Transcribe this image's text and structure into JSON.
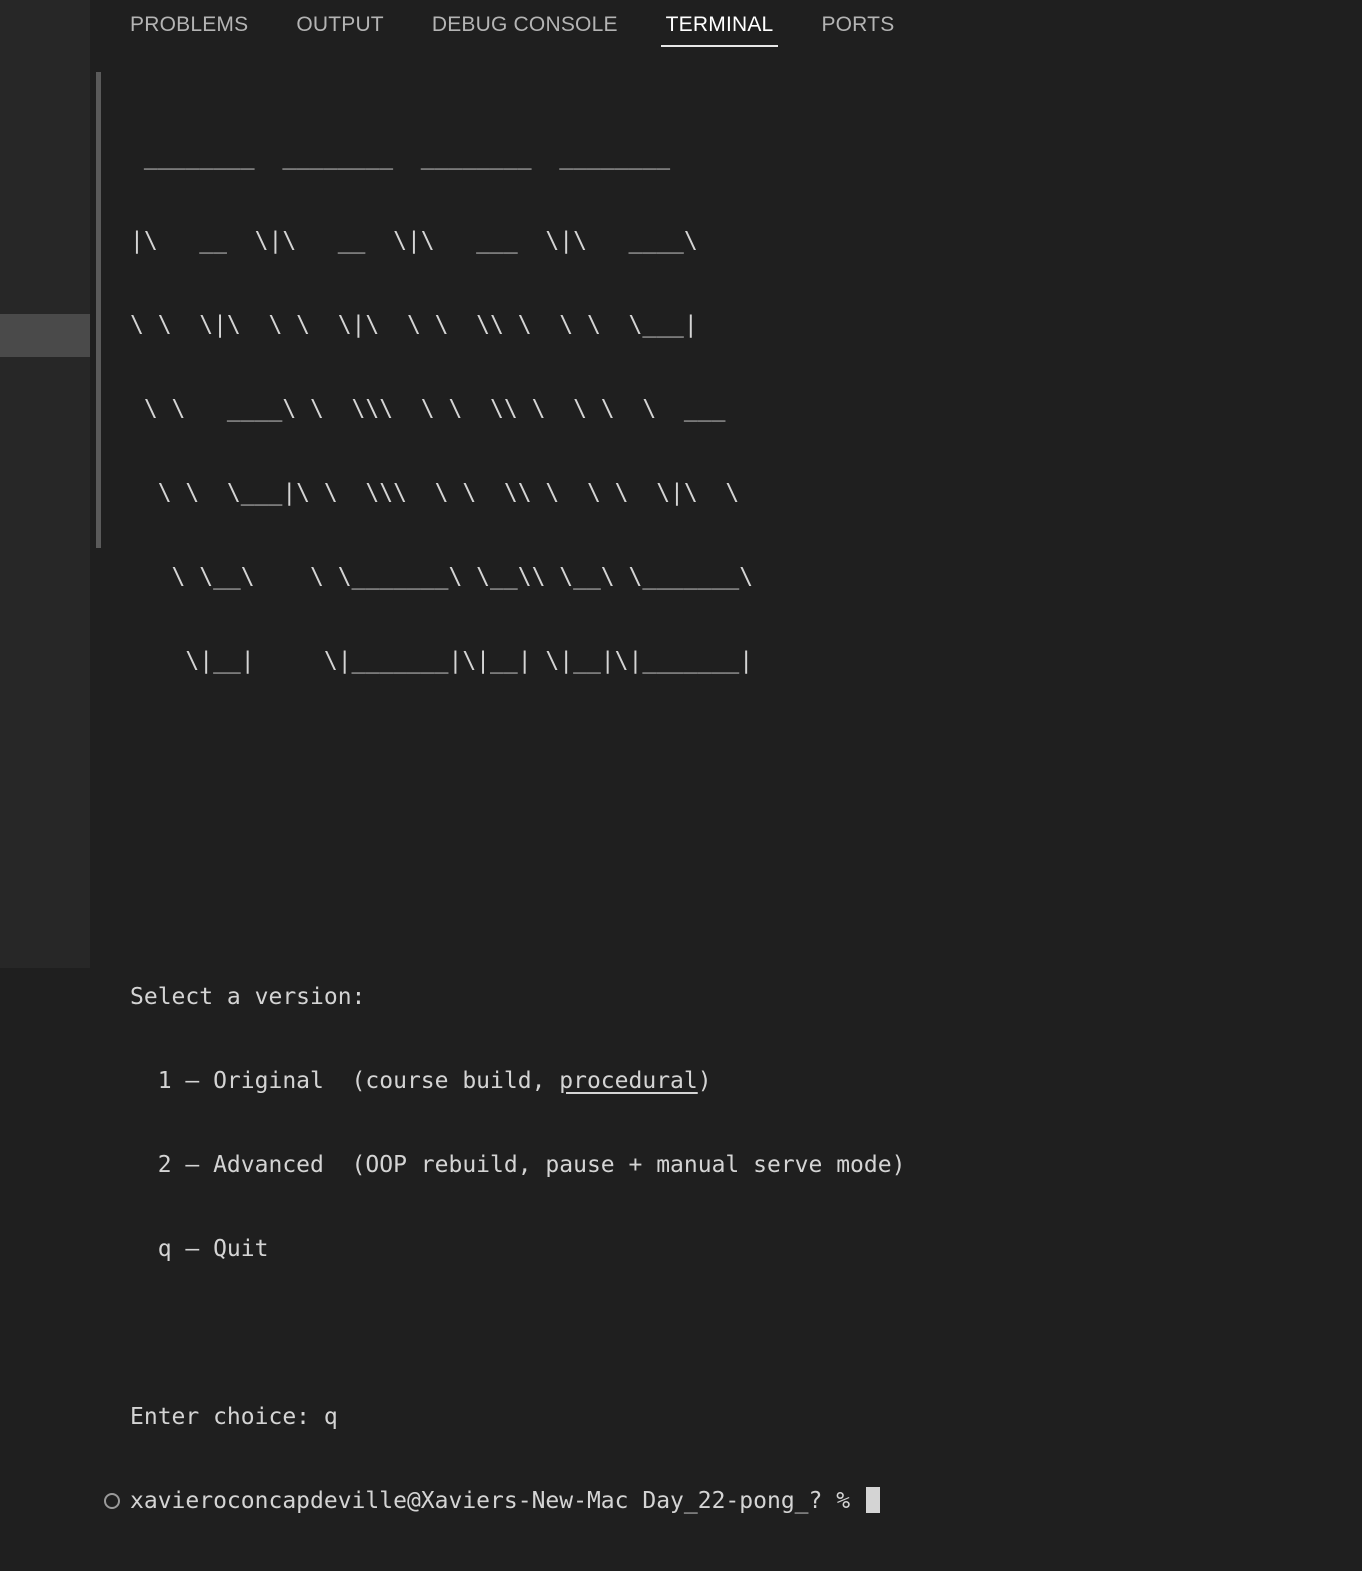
{
  "tabs": [
    {
      "label": "PROBLEMS"
    },
    {
      "label": "OUTPUT"
    },
    {
      "label": "DEBUG CONSOLE"
    },
    {
      "label": "TERMINAL"
    },
    {
      "label": "PORTS"
    }
  ],
  "active_tab": "TERMINAL",
  "terminal": {
    "ascii_art": [
      " ________  ________  ________  ________",
      "|\\   __  \\|\\   __  \\|\\   ___  \\|\\   ____\\",
      "\\ \\  \\|\\  \\ \\  \\|\\  \\ \\  \\\\ \\  \\ \\  \\___|",
      " \\ \\   ____\\ \\  \\\\\\  \\ \\  \\\\ \\  \\ \\  \\  ___",
      "  \\ \\  \\___|\\ \\  \\\\\\  \\ \\  \\\\ \\  \\ \\  \\|\\  \\",
      "   \\ \\__\\    \\ \\_______\\ \\__\\\\ \\__\\ \\_______\\",
      "    \\|__|     \\|_______|\\|__| \\|__|\\|_______|"
    ],
    "menu_heading": "Select a version:",
    "option1_prefix": "  1 — Original  (course build, ",
    "option1_underlined": "procedural",
    "option1_suffix": ")",
    "option2": "  2 — Advanced  (OOP rebuild, pause + manual serve mode)",
    "option3": "  q — Quit",
    "choice_line": "Enter choice: q",
    "prompt": "xavieroconcapdeville@Xaviers-New-Mac Day_22-pong_? % "
  }
}
